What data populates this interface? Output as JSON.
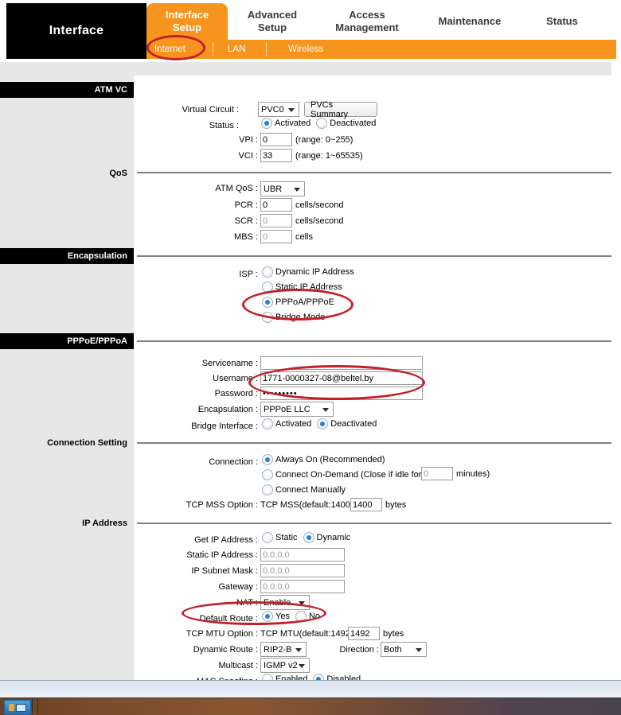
{
  "header": {
    "brand": "Interface",
    "main_tabs": [
      {
        "label": "Interface\nSetup",
        "active": true
      },
      {
        "label": "Advanced\nSetup",
        "active": false
      },
      {
        "label": "Access\nManagement",
        "active": false
      },
      {
        "label": "Maintenance",
        "active": false
      },
      {
        "label": "Status",
        "active": false
      }
    ],
    "sub_tabs": [
      {
        "label": "Internet",
        "active": true,
        "annotated": true
      },
      {
        "label": "LAN",
        "active": false
      },
      {
        "label": "Wireless",
        "active": false
      }
    ]
  },
  "sections": {
    "atm_vc": "ATM VC",
    "qos": "QoS",
    "encapsulation": "Encapsulation",
    "pppoe_pppoa": "PPPoE/PPPoA",
    "connection_setting": "Connection Setting",
    "ip_address": "IP Address"
  },
  "atm_vc": {
    "virtual_circuit_label": "Virtual Circuit :",
    "virtual_circuit_value": "PVC0",
    "pvcs_summary_button": "PVCs Summary",
    "status_label": "Status :",
    "status_options": [
      "Activated",
      "Deactivated"
    ],
    "status_selected": "Activated",
    "vpi_label": "VPI :",
    "vpi_value": "0",
    "vpi_range": "(range: 0~255)",
    "vci_label": "VCI :",
    "vci_value": "33",
    "vci_range": "(range: 1~65535)"
  },
  "qos": {
    "atm_qos_label": "ATM QoS :",
    "atm_qos_value": "UBR",
    "pcr_label": "PCR :",
    "pcr_value": "0",
    "pcr_unit": "cells/second",
    "scr_label": "SCR :",
    "scr_value": "0",
    "scr_unit": "cells/second",
    "mbs_label": "MBS :",
    "mbs_value": "0",
    "mbs_unit": "cells"
  },
  "encapsulation": {
    "isp_label": "ISP :",
    "options": [
      "Dynamic IP Address",
      "Static IP Address",
      "PPPoA/PPPoE",
      "Bridge Mode"
    ],
    "selected": "PPPoA/PPPoE"
  },
  "pppoe": {
    "servicename_label": "Servicename :",
    "servicename_value": "",
    "username_label": "Username :",
    "username_value": "1771-0000327-08@beltel.by",
    "password_label": "Password :",
    "password_value": "•••••••••",
    "encapsulation_label": "Encapsulation :",
    "encapsulation_value": "PPPoE LLC",
    "bridge_interface_label": "Bridge Interface :",
    "bridge_interface_options": [
      "Activated",
      "Deactivated"
    ],
    "bridge_interface_selected": "Deactivated"
  },
  "connection": {
    "connection_label": "Connection :",
    "option_always_on": "Always On (Recommended)",
    "option_on_demand_pre": "Connect On-Demand (Close if idle for",
    "on_demand_idle_value": "0",
    "option_on_demand_post": "minutes)",
    "option_manually": "Connect Manually",
    "selected": "Always On (Recommended)",
    "tcp_mss_label": "TCP MSS Option :",
    "tcp_mss_prefix": "TCP MSS(default:1400)",
    "tcp_mss_value": "1400",
    "tcp_mss_unit": "bytes"
  },
  "ip_address": {
    "get_ip_label": "Get IP Address :",
    "get_ip_options": [
      "Static",
      "Dynamic"
    ],
    "get_ip_selected": "Dynamic",
    "static_ip_label": "Static IP Address :",
    "static_ip_value": "0.0.0.0",
    "subnet_label": "IP Subnet Mask :",
    "subnet_value": "0.0.0.0",
    "gateway_label": "Gateway :",
    "gateway_value": "0.0.0.0",
    "nat_label": "NAT :",
    "nat_value": "Enable",
    "default_route_label": "Default Route :",
    "default_route_options": [
      "Yes",
      "No"
    ],
    "default_route_selected": "Yes",
    "tcp_mtu_label": "TCP MTU Option :",
    "tcp_mtu_prefix": "TCP MTU(default:1492)",
    "tcp_mtu_value": "1492",
    "tcp_mtu_unit": "bytes",
    "dynamic_route_label": "Dynamic Route :",
    "dynamic_route_value": "RIP2-B",
    "direction_label": "Direction :",
    "direction_value": "Both",
    "multicast_label": "Multicast :",
    "multicast_value": "IGMP v2",
    "mac_spoofing_label": "MAC Spoofing :",
    "mac_spoofing_options": [
      "Enabled",
      "Disabled"
    ],
    "mac_spoofing_selected": "Disabled"
  },
  "colors": {
    "accent_orange": "#f7941e",
    "label_black": "#000000",
    "sidebar_grey": "#e7e7e7",
    "annotation_red": "#c2202a",
    "radio_blue": "#1a84d6"
  }
}
